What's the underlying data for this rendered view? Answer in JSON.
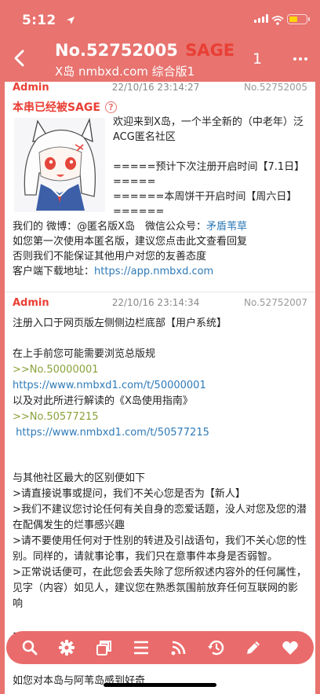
{
  "status_bar": {
    "time": "5:12"
  },
  "header": {
    "thread_no": "No.52752005",
    "sage_tag": "SAGE",
    "subtitle": "X岛 nmbxd.com 综合版1",
    "page": "1"
  },
  "posts": [
    {
      "author": "Admin",
      "time": "22/10/16 23:14:27",
      "id": "No.52752005",
      "sage_notice": "本串已经被SAGE",
      "help": "?",
      "lines": [
        "欢迎来到X岛，一个半全新的（中老年）泛ACG匿名社区",
        "=====预计下次注册开启时间【7.1日】=====",
        "======本周饼干开启时间【周六日】======"
      ],
      "weibo_prefix": "我们的 微博：@匿名版X岛　微信公众号：",
      "wechat_link": "矛盾苇草",
      "line_new": "如您第一次使用本匿名版，建议您点击此文查看回复",
      "line_warn": "否则我们不能保证其他用户对您的友善态度",
      "client_prefix": "客户端下载地址：",
      "client_link": "https://app.nmbxd.com"
    },
    {
      "author": "Admin",
      "time": "22/10/16 23:14:34",
      "id": "No.52752007",
      "l1": "注册入口于网页版左侧侧边栏底部【用户系统】",
      "l2": "在上手前您可能需要浏览总版规",
      "ref1": ">>No.50000001",
      "url1": "https://www.nmbxd1.com/t/50000001",
      "l3": "以及对此所进行解读的《X岛使用指南》",
      "ref2": ">>No.50577215",
      "url2": " https://www.nmbxd1.com/t/50577215",
      "l4": "与其他社区最大的区别便如下",
      "l5": ">请直接说事或提问，我们不关心您是否为【新人】",
      "l6": ">我们不建议您讨论任何有关自身的恋爱话题，没人对您及您的潜在配偶发生的烂事感兴趣",
      "l7": ">请不要使用任何对于性别的转进及引战语句，我们不关心您的性别。同样的，请就事论事，我们只在意事件本身是否弱智。",
      "l8": ">正常说话便可，在此您会丢失除了您所叙述内容外的任何属性，见字（内容）如见人，建议您在熟悉氛围前放弃任何互联网的影响",
      "l9": "=================================================================",
      "l10": "如您对本岛与阿苇岛感到好奇"
    }
  ],
  "toolbar": {
    "icons": [
      "search-icon",
      "gear-icon",
      "copy-icon",
      "menu-icon",
      "rss-icon",
      "history-icon",
      "edit-icon",
      "heart-icon"
    ]
  },
  "colors": {
    "accent": "#e8736f",
    "sage": "#e93f35",
    "link": "#2e7ab8",
    "ref": "#8ba23b"
  }
}
